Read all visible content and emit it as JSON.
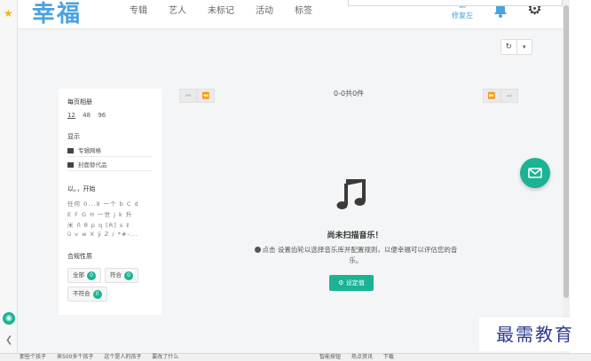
{
  "app": {
    "logo": "幸福",
    "nav": [
      "专辑",
      "艺人",
      "未标记",
      "活动",
      "标签"
    ],
    "fixer_label": "修复左",
    "fixer_icon": "infinity-icon",
    "notification_icon": "bell-icon",
    "settings_icon": "gear-icon",
    "accent_color": "#1bb394",
    "logo_color": "#4aa3de"
  },
  "toolbar": {
    "refresh_icon": "↻",
    "dropdown_icon": "▾"
  },
  "pager": {
    "count_text": "0-0共0件",
    "first": "⏮",
    "prev": "⏪",
    "next": "⏩",
    "last": "⏭"
  },
  "sidebar": {
    "per_page_title": "每页相册",
    "per_page_options": [
      "12",
      "48",
      "96"
    ],
    "per_page_selected": "12",
    "display_title": "显示",
    "display_items": [
      "专辑网格",
      "封面替代品"
    ],
    "starts_title": "以。，开始",
    "alpha_rows": [
      "任何  0...9  一个  b  C  d",
      "E  F  G  H  一世  j  k  升",
      "米  ñ  θ  p  q  [R]  s  ‡",
      "ü  v  w  X  ÿ  Z  / *#-..."
    ],
    "match_title": "合规性质",
    "match_pills": [
      {
        "label": "全部",
        "count": "0"
      },
      {
        "label": "符合",
        "count": "0"
      },
      {
        "label": "不符合",
        "count": "0"
      }
    ]
  },
  "empty": {
    "title": "尚未扫描音乐！",
    "description": "点击 设置齿轮以选择音乐库并配置规则，以便幸福可以评估您的音乐。",
    "button_label": "设定值"
  },
  "watermark": "最需教育",
  "taskbar": {
    "left": [
      "那些个孩子",
      "来500多个孩子",
      "这个是人的孩子",
      "要改了什么"
    ],
    "right": [
      "智能按钮",
      "热点资讯",
      "下载"
    ]
  }
}
